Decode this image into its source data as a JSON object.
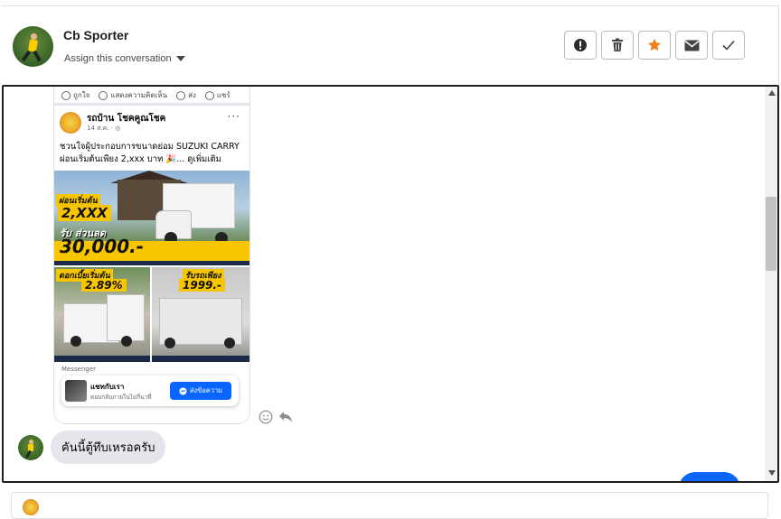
{
  "header": {
    "contact_name": "Cb Sporter",
    "assign_label": "Assign this conversation",
    "actions": [
      {
        "name": "report-button",
        "icon": "alert-circle-icon"
      },
      {
        "name": "delete-button",
        "icon": "trash-icon"
      },
      {
        "name": "star-button",
        "icon": "star-icon"
      },
      {
        "name": "mail-button",
        "icon": "envelope-icon"
      },
      {
        "name": "done-button",
        "icon": "check-icon"
      }
    ],
    "accent_color": "#f07e1b"
  },
  "shared_post": {
    "reactions": {
      "like": "ถูกใจ",
      "comment": "แสดงความคิดเห็น",
      "send": "ส่ง",
      "share": "แชร์"
    },
    "page_name": "รถบ้าน โชคคูณโชค",
    "post_meta": "14 ส.ค. · ◎",
    "more": "···",
    "text_line1": "ชวนใจผู้ประกอบการขนาดย่อม SUZUKI CARRY",
    "text_line2": "ผ่อนเริ่มต้นเพียง 2,xxx บาท 🎉... ดูเพิ่มเติม",
    "promo": {
      "installment_label": "ผ่อนเริ่มต้น",
      "installment_value": "2,XXX",
      "discount_label": "รับ ส่วนลด",
      "discount_value": "30,000.-",
      "interest_label": "ดอกเบี้ยเริ่มต้น",
      "interest_value": "2.89%",
      "down_label": "รับรถเพียง",
      "down_value": "1999.-"
    },
    "messenger_label": "Messenger",
    "cta_title": "แชทกับเรา",
    "cta_subtitle": "ตอบกลับภายในไม่กี่นาที",
    "cta_button": "ส่งข้อความ"
  },
  "message": {
    "text": "คันนี้ตู้ทึบเหรอครับ"
  },
  "colors": {
    "messenger_blue": "#0866ff",
    "bubble_gray": "#e4e6eb",
    "promo_yellow": "#f7c600"
  }
}
